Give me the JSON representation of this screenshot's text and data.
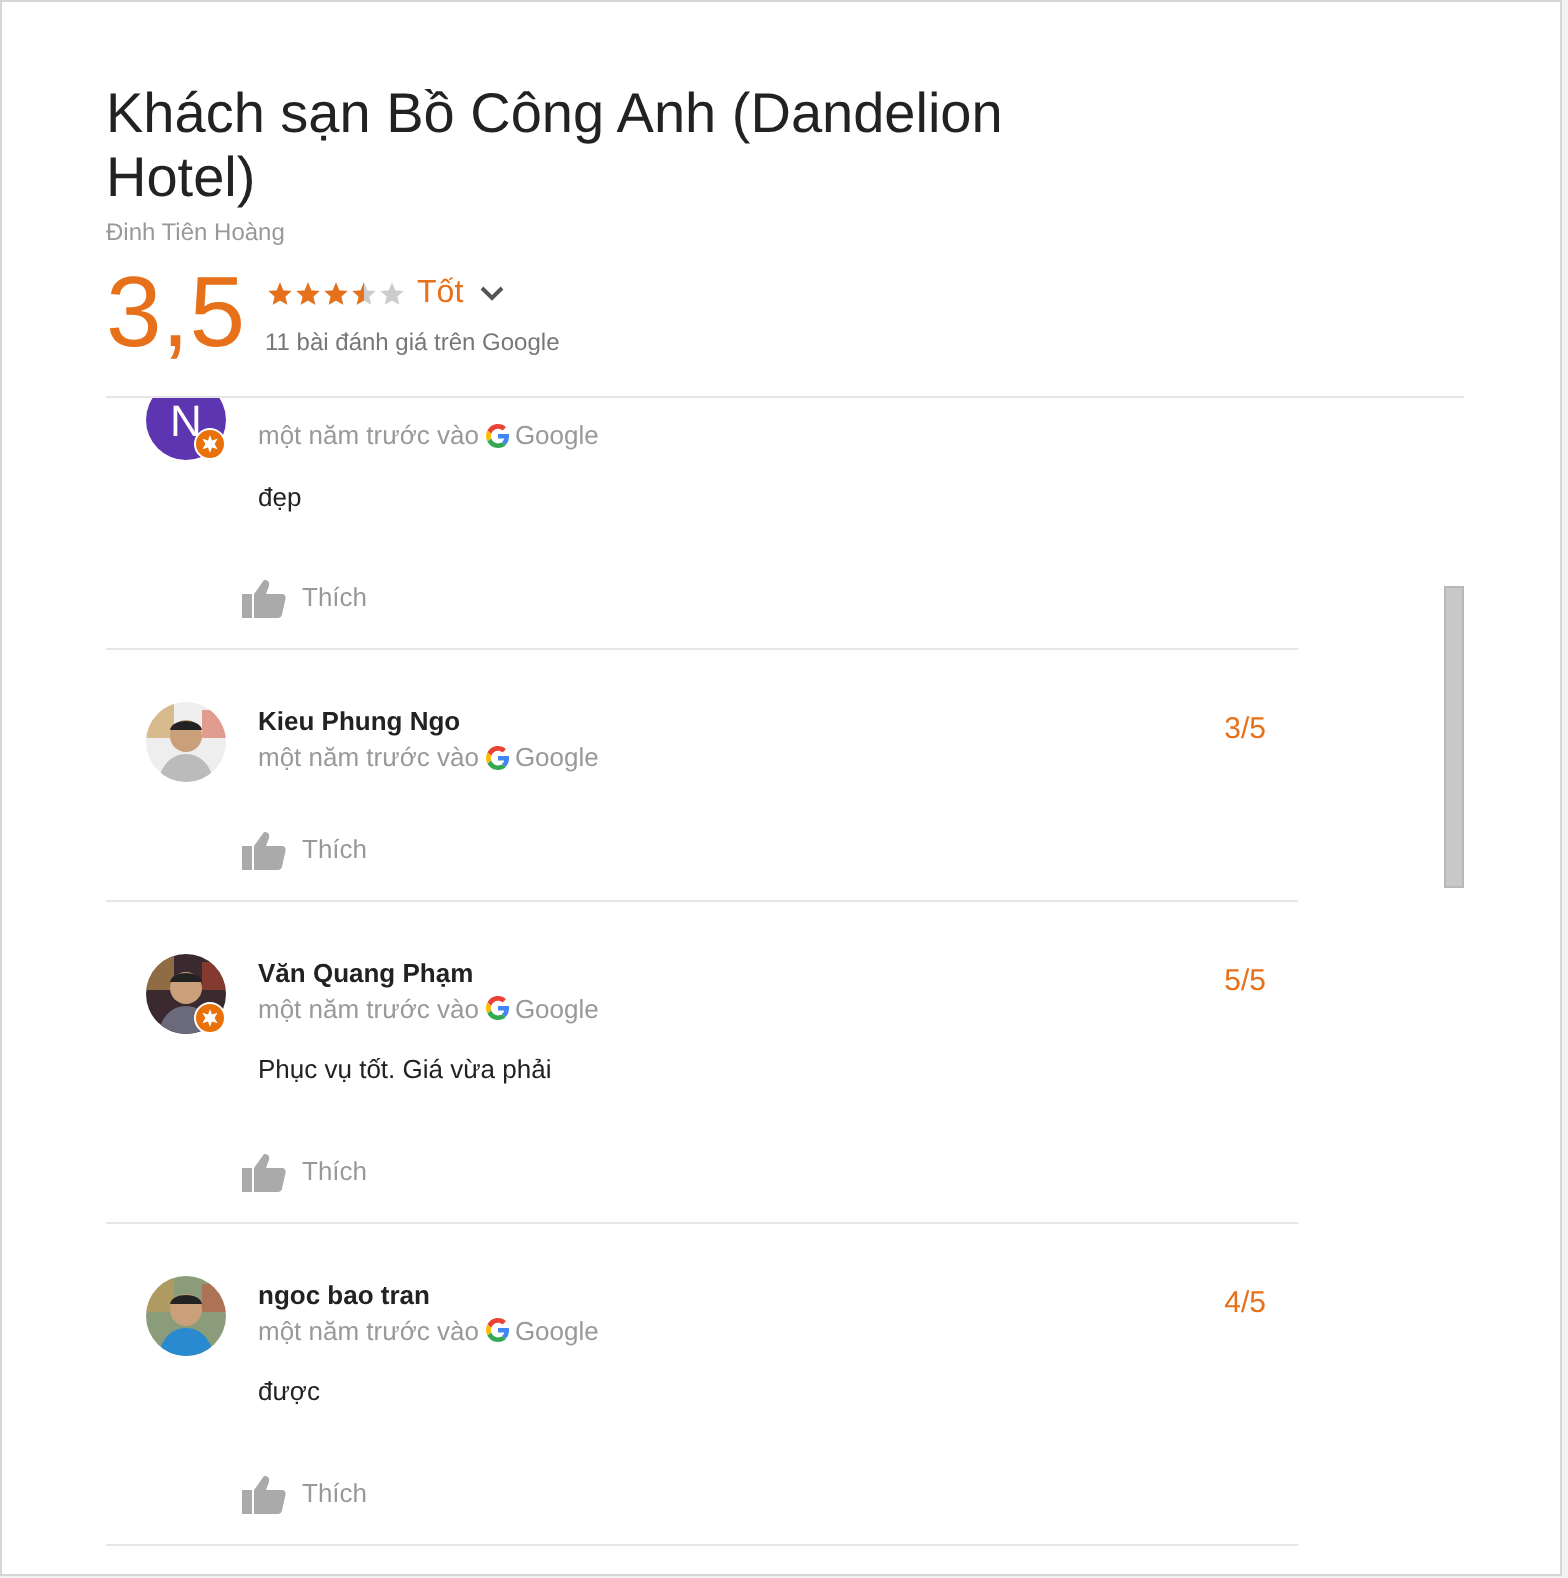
{
  "header": {
    "title": "Khách sạn Bồ Công Anh (Dandelion Hotel)",
    "address": "Đinh Tiên Hoàng",
    "score": "3,5",
    "stars": 3.5,
    "rating_label": "Tốt",
    "review_count": "11 bài đánh giá trên Google"
  },
  "reviews": [
    {
      "avatar": {
        "kind": "letter",
        "letter": "N",
        "local_guide": true
      },
      "time": "một năm trước vào",
      "source": "Google",
      "text": "đẹp",
      "like": "Thích"
    },
    {
      "avatar": {
        "kind": "picture",
        "local_guide": false
      },
      "name": "Kieu Phung Ngo",
      "rating": "3/5",
      "time": "một năm trước vào",
      "source": "Google",
      "like": "Thích"
    },
    {
      "avatar": {
        "kind": "picture",
        "local_guide": true
      },
      "name": "Văn Quang Phạm",
      "rating": "5/5",
      "time": "một năm trước vào",
      "source": "Google",
      "text": "Phục vụ tốt. Giá vừa phải",
      "like": "Thích"
    },
    {
      "avatar": {
        "kind": "picture",
        "local_guide": false
      },
      "name": "ngoc bao tran",
      "rating": "4/5",
      "time": "một năm trước vào",
      "source": "Google",
      "text": "được",
      "like": "Thích"
    }
  ]
}
